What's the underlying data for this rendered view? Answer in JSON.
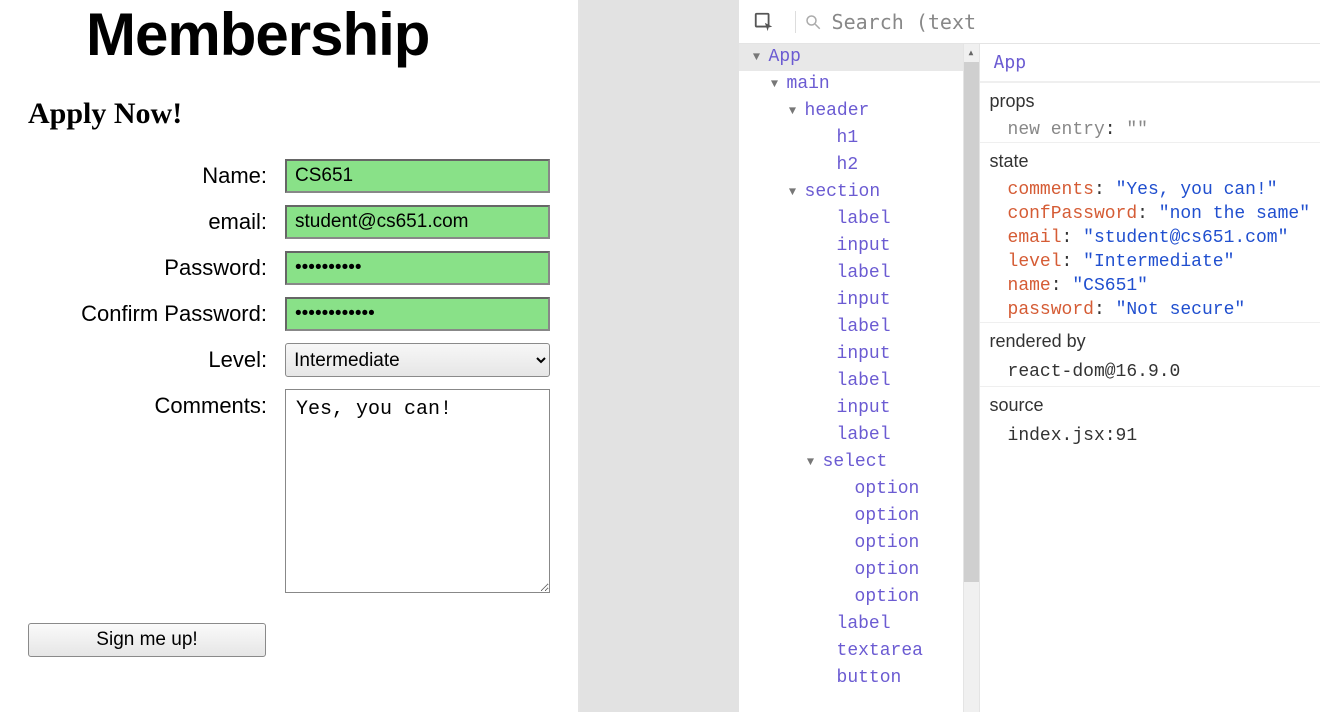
{
  "app": {
    "title": "Membership",
    "subtitle": "Apply Now!",
    "labels": {
      "name": "Name:",
      "email": "email:",
      "password": "Password:",
      "confirm_password": "Confirm Password:",
      "level": "Level:",
      "comments": "Comments:"
    },
    "values": {
      "name": "CS651",
      "email": "student@cs651.com",
      "password": "Not secure",
      "confirm_password": "non the same",
      "level": "Intermediate",
      "comments": "Yes, you can!"
    },
    "submit_label": "Sign me up!"
  },
  "devtools": {
    "search_placeholder": "Search (text",
    "breadcrumb": "App",
    "tree": [
      {
        "label": "App",
        "indent": 12,
        "twisty": "▼",
        "selected": true
      },
      {
        "label": "main",
        "indent": 30,
        "twisty": "▼"
      },
      {
        "label": "header",
        "indent": 48,
        "twisty": "▼"
      },
      {
        "label": "h1",
        "indent": 80,
        "twisty": ""
      },
      {
        "label": "h2",
        "indent": 80,
        "twisty": ""
      },
      {
        "label": "section",
        "indent": 48,
        "twisty": "▼"
      },
      {
        "label": "label",
        "indent": 80,
        "twisty": ""
      },
      {
        "label": "input",
        "indent": 80,
        "twisty": ""
      },
      {
        "label": "label",
        "indent": 80,
        "twisty": ""
      },
      {
        "label": "input",
        "indent": 80,
        "twisty": ""
      },
      {
        "label": "label",
        "indent": 80,
        "twisty": ""
      },
      {
        "label": "input",
        "indent": 80,
        "twisty": ""
      },
      {
        "label": "label",
        "indent": 80,
        "twisty": ""
      },
      {
        "label": "input",
        "indent": 80,
        "twisty": ""
      },
      {
        "label": "label",
        "indent": 80,
        "twisty": ""
      },
      {
        "label": "select",
        "indent": 66,
        "twisty": "▼"
      },
      {
        "label": "option",
        "indent": 98,
        "twisty": ""
      },
      {
        "label": "option",
        "indent": 98,
        "twisty": ""
      },
      {
        "label": "option",
        "indent": 98,
        "twisty": ""
      },
      {
        "label": "option",
        "indent": 98,
        "twisty": ""
      },
      {
        "label": "option",
        "indent": 98,
        "twisty": ""
      },
      {
        "label": "label",
        "indent": 80,
        "twisty": ""
      },
      {
        "label": "textarea",
        "indent": 80,
        "twisty": ""
      },
      {
        "label": "button",
        "indent": 80,
        "twisty": ""
      }
    ],
    "props": {
      "heading": "props",
      "items": [
        {
          "key": "new entry",
          "value": "\"\""
        }
      ]
    },
    "state": {
      "heading": "state",
      "items": [
        {
          "key": "comments",
          "value": "\"Yes, you can!\""
        },
        {
          "key": "confPassword",
          "value": "\"non the same\""
        },
        {
          "key": "email",
          "value": "\"student@cs651.com\""
        },
        {
          "key": "level",
          "value": "\"Intermediate\""
        },
        {
          "key": "name",
          "value": "\"CS651\""
        },
        {
          "key": "password",
          "value": "\"Not secure\""
        }
      ]
    },
    "rendered_by": {
      "heading": "rendered by",
      "value": "react-dom@16.9.0"
    },
    "source": {
      "heading": "source",
      "value": "index.jsx:91"
    }
  }
}
